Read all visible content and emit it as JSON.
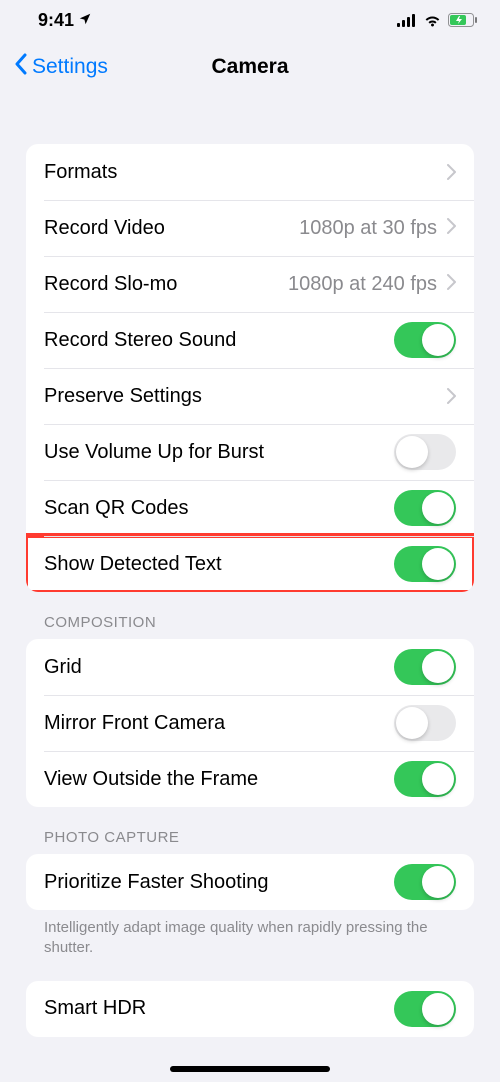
{
  "statusbar": {
    "time": "9:41"
  },
  "nav": {
    "back_label": "Settings",
    "title": "Camera"
  },
  "section1": {
    "rows": {
      "formats": {
        "label": "Formats"
      },
      "record_video": {
        "label": "Record Video",
        "value": "1080p at 30 fps"
      },
      "record_slomo": {
        "label": "Record Slo-mo",
        "value": "1080p at 240 fps"
      },
      "record_stereo": {
        "label": "Record Stereo Sound",
        "on": true
      },
      "preserve_settings": {
        "label": "Preserve Settings"
      },
      "volume_burst": {
        "label": "Use Volume Up for Burst",
        "on": false
      },
      "scan_qr": {
        "label": "Scan QR Codes",
        "on": true
      },
      "show_detected_text": {
        "label": "Show Detected Text",
        "on": true
      }
    }
  },
  "section2": {
    "header": "COMPOSITION",
    "rows": {
      "grid": {
        "label": "Grid",
        "on": true
      },
      "mirror": {
        "label": "Mirror Front Camera",
        "on": false
      },
      "view_outside": {
        "label": "View Outside the Frame",
        "on": true
      }
    }
  },
  "section3": {
    "header": "PHOTO CAPTURE",
    "rows": {
      "prioritize": {
        "label": "Prioritize Faster Shooting",
        "on": true
      },
      "smart_hdr": {
        "label": "Smart HDR",
        "on": true
      }
    },
    "footer": "Intelligently adapt image quality when rapidly pressing the shutter."
  }
}
